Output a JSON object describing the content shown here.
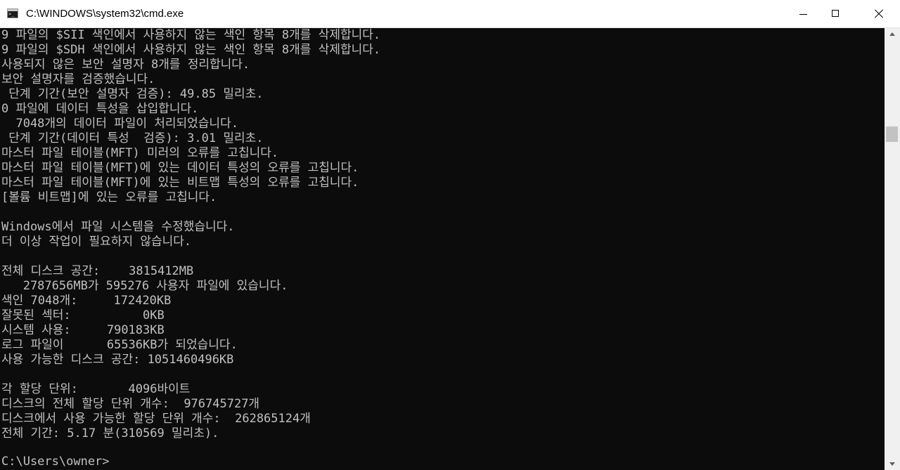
{
  "window": {
    "title": "C:\\WINDOWS\\system32\\cmd.exe",
    "icon": "cmd-icon",
    "controls": [
      "minimize-icon",
      "maximize-icon",
      "close-icon"
    ]
  },
  "console": {
    "lines": [
      "9 파일의 $SII 색인에서 사용하지 않는 색인 항목 8개를 삭제합니다.",
      "9 파일의 $SDH 색인에서 사용하지 않는 색인 항목 8개를 삭제합니다.",
      "사용되지 않은 보안 설명자 8개를 정리합니다.",
      "보안 설명자를 검증했습니다.",
      " 단계 기간(보안 설명자 검증): 49.85 밀리초.",
      "0 파일에 데이터 특성을 삽입합니다.",
      "  7048개의 데이터 파일이 처리되었습니다.",
      " 단계 기간(데이터 특성  검증): 3.01 밀리초.",
      "마스터 파일 테이블(MFT) 미러의 오류를 고칩니다.",
      "마스터 파일 테이블(MFT)에 있는 데이터 특성의 오류를 고칩니다.",
      "마스터 파일 테이블(MFT)에 있는 비트맵 특성의 오류를 고칩니다.",
      "[볼륨 비트맵]에 있는 오류를 고칩니다.",
      "",
      "Windows에서 파일 시스템을 수정했습니다.",
      "더 이상 작업이 필요하지 않습니다.",
      "",
      "전체 디스크 공간:    3815412MB",
      "   2787656MB가 595276 사용자 파일에 있습니다.",
      "색인 7048개:     172420KB",
      "잘못된 섹터:          0KB",
      "시스템 사용:     790183KB",
      "로그 파일이      65536KB가 되었습니다.",
      "사용 가능한 디스크 공간: 1051460496KB",
      "",
      "각 할당 단위:       4096바이트",
      "디스크의 전체 할당 단위 개수:  976745727개",
      "디스크에서 사용 가능한 할당 단위 개수:  262865124개",
      "전체 기간: 5.17 분(310569 밀리초).",
      "",
      "C:\\Users\\owner>"
    ]
  },
  "colors": {
    "console_background": "#0c0c0c",
    "console_text": "#c0c0c0",
    "titlebar_background": "#ffffff",
    "scrollbar_track": "#f0f0f0",
    "scrollbar_thumb": "#c2c2c2"
  }
}
